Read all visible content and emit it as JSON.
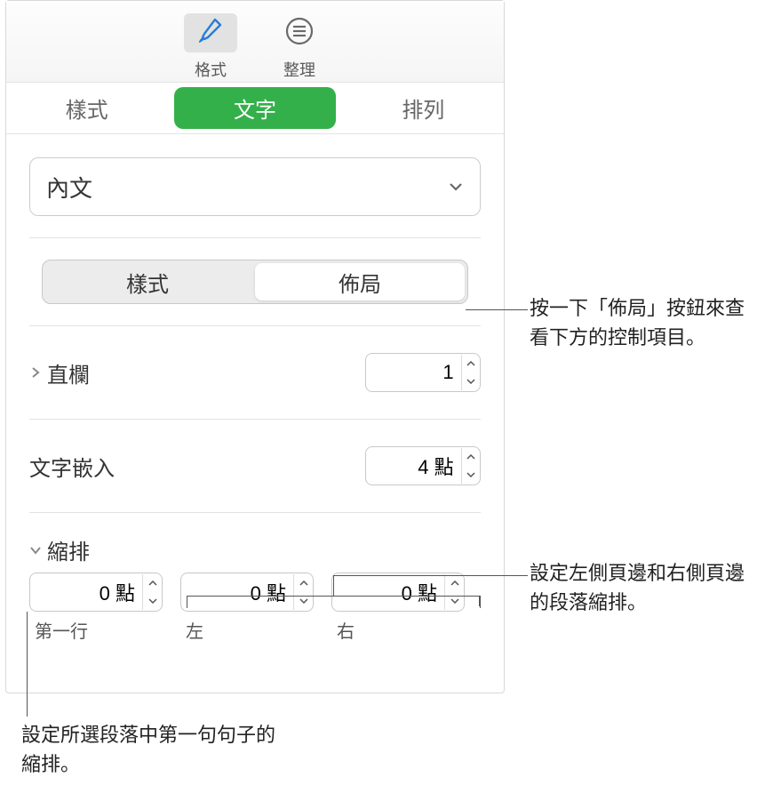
{
  "toolbar": {
    "format_label": "格式",
    "organize_label": "整理"
  },
  "subtabs": {
    "style_label": "樣式",
    "text_label": "文字",
    "arrange_label": "排列"
  },
  "paragraph_style_select": "內文",
  "segmented": {
    "style_label": "樣式",
    "layout_label": "佈局"
  },
  "columns": {
    "label": "直欄",
    "value": "1"
  },
  "text_inset": {
    "label": "文字嵌入",
    "value": "4 點"
  },
  "indent": {
    "section_label": "縮排",
    "first_line": {
      "value": "0 點",
      "caption": "第一行"
    },
    "left": {
      "value": "0 點",
      "caption": "左"
    },
    "right": {
      "value": "0 點",
      "caption": "右"
    }
  },
  "callouts": {
    "layout_btn": "按一下「佈局」按鈕來查看下方的控制項目。",
    "lr_margin": "設定左側頁邊和右側頁邊的段落縮排。",
    "first_line": "設定所選段落中第一句句子的縮排。"
  }
}
